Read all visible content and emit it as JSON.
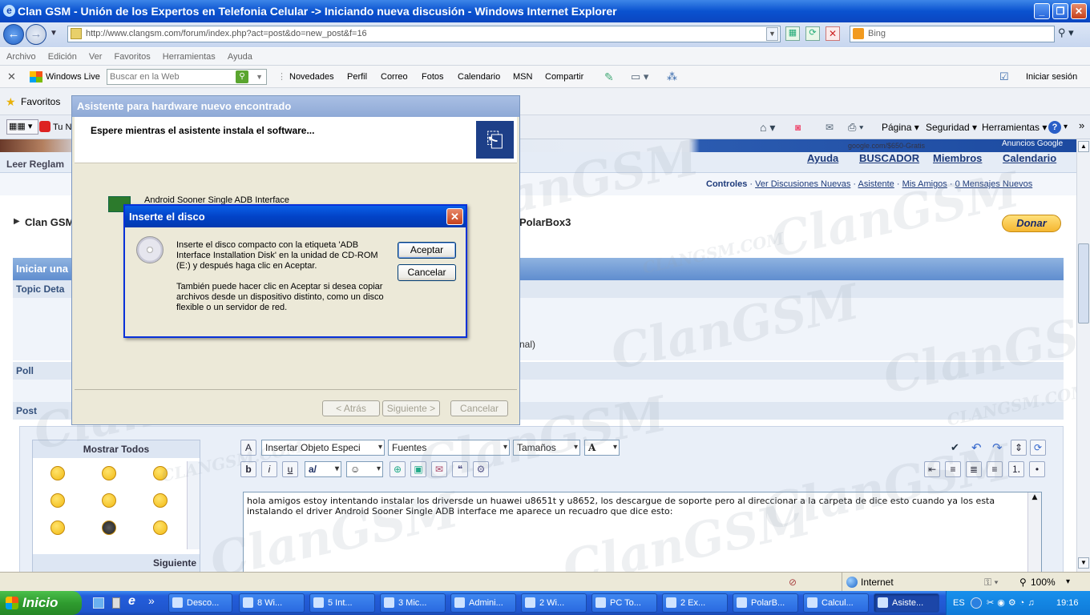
{
  "window": {
    "title": "Clan GSM - Unión de los Expertos en Telefonia Celular -> Iniciando nueva discusión - Windows Internet Explorer",
    "address": "http://www.clangsm.com/forum/index.php?act=post&do=new_post&f=16",
    "search_placeholder": "Bing"
  },
  "menu": [
    "Archivo",
    "Edición",
    "Ver",
    "Favoritos",
    "Herramientas",
    "Ayuda"
  ],
  "live_toolbar": {
    "brand": "Windows Live",
    "search_placeholder": "Buscar en la Web",
    "items": [
      "Novedades",
      "Perfil",
      "Correo",
      "Fotos",
      "Calendario",
      "MSN",
      "Compartir"
    ],
    "signin": "Iniciar sesión"
  },
  "favorites": {
    "label": "Favoritos",
    "tab_partial": "Tu N"
  },
  "command_bar": [
    "Página",
    "Seguridad",
    "Herramientas"
  ],
  "forum": {
    "ad_text": "google.com/$650-Gratis",
    "ad_label": "Anuncios Google",
    "read_rules": "Leer Reglam",
    "nav_links": [
      "Ayuda",
      "BUSCADOR",
      "Miembros",
      "Calendario"
    ],
    "user_links": [
      "Controles",
      "Ver Discusiones Nuevas",
      "Asistente",
      "Mis Amigos",
      "0 Mensajes Nuevos"
    ],
    "breadcrumb_start": "Clan GSM",
    "breadcrumb_end": "PolarBox3",
    "donate": "Donar",
    "section_title": "Iniciar una",
    "topic_details": "Topic Deta",
    "optional_suffix": "nal)",
    "poll": "Poll",
    "post": "Post",
    "emoticons_header": "Mostrar Todos",
    "emoticons_next": "Siguiente",
    "editor": {
      "insert_object": "Insertar Objeto Especi",
      "fonts": "Fuentes",
      "sizes": "Tamaños",
      "text": "hola amigos estoy intentando instalar los driversde un huawei u8651t y u8652, los descargue de soporte pero al direccionar a la carpeta de dice esto cuando ya los esta instalando el driver Android Sooner Single ADB interface me aparece un recuadro que dice esto:"
    }
  },
  "wizard": {
    "title": "Asistente para hardware nuevo encontrado",
    "heading": "Espere mientras el asistente instala el software...",
    "device": "Android Sooner Single ADB Interface",
    "buttons": [
      "< Atrás",
      "Siguiente >",
      "Cancelar"
    ]
  },
  "modal": {
    "title": "Inserte el disco",
    "close": "✕",
    "message1": "Inserte el disco compacto con la etiqueta 'ADB Interface Installation Disk' en la unidad de CD-ROM (E:) y después haga clic en Aceptar.",
    "message2": "También puede hacer clic en Aceptar si desea copiar archivos desde un dispositivo distinto, como un disco flexible o un servidor de red.",
    "ok": "Aceptar",
    "cancel": "Cancelar"
  },
  "status_bar": {
    "zone": "Internet",
    "zoom": "100%"
  },
  "taskbar": {
    "start": "Inicio",
    "tasks": [
      "Desco...",
      "8 Wi...",
      "5 Int...",
      "3 Mic...",
      "Admini...",
      "2 Wi...",
      "PC To...",
      "2 Ex...",
      "PolarB...",
      "Calcul...",
      "Asiste..."
    ],
    "lang": "ES",
    "clock": "19:16"
  },
  "watermark": "ClanGSM",
  "watermark_small": "CLANGSM.COM"
}
